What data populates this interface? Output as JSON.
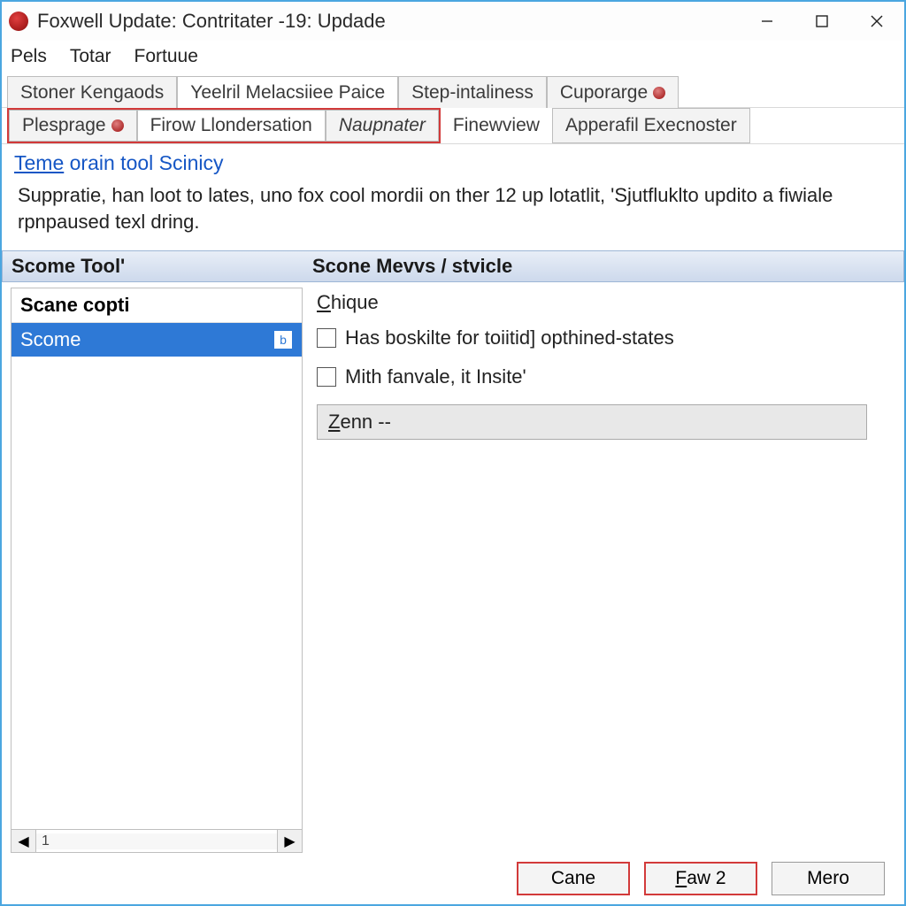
{
  "titlebar": {
    "title": "Foxwell Update: Contritater -19: Updade"
  },
  "menubar": {
    "items": [
      "Pels",
      "Totar",
      "Fortuue"
    ]
  },
  "tabs_row1": [
    {
      "label": "Stoner Kengaods",
      "active": false,
      "dot": false
    },
    {
      "label": "Yeelril Melacsiiee Paice",
      "active": true,
      "dot": false
    },
    {
      "label": "Step-intaliness",
      "active": false,
      "dot": false
    },
    {
      "label": "Cuporarge",
      "active": false,
      "dot": true
    }
  ],
  "tabs_row2_group": [
    {
      "label": "Plesprage",
      "dot": true
    },
    {
      "label": "Firow Llondersation",
      "dot": false
    },
    {
      "label": "Naupnater",
      "dot": false,
      "italic": true
    }
  ],
  "tabs_row2_rest": [
    {
      "label": "Finewview"
    },
    {
      "label": "Apperafil Execnoster"
    }
  ],
  "section": {
    "heading_underlined": "Teme",
    "heading_rest": " orain tool Scinicy",
    "description": "Suppratie, han loot to lates, uno fox cool mordii on ther 12 up lotatlit, 'Sjutfluklto updito a fiwiale rpnpaused texl dring."
  },
  "columns": {
    "left_header": "Scome Tool'",
    "right_header": "Scone Mevvs / stvicle"
  },
  "left_pane": {
    "header": "Scane copti",
    "item": "Scome",
    "item_badge": "b",
    "scroll_page": "1"
  },
  "right_pane": {
    "heading_u": "C",
    "heading_rest": "hique",
    "checkbox1": "Has boskilte for toiitid] opthined-states",
    "checkbox2": "Mith fanvale, it Insite'",
    "zenn_u": "Z",
    "zenn_rest": "enn --"
  },
  "footer": {
    "btn1": "Cane",
    "btn2_u": "F",
    "btn2_rest": "aw 2",
    "btn3": "Mero"
  }
}
